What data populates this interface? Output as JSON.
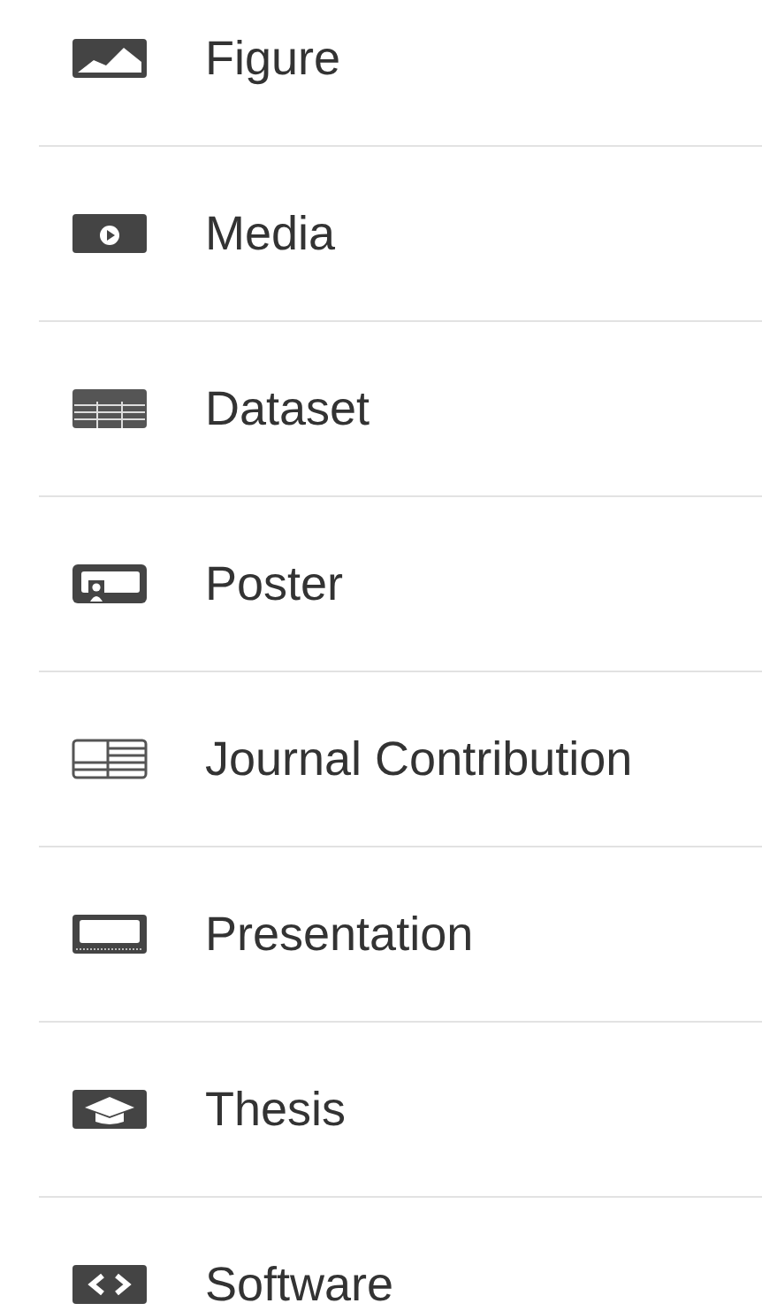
{
  "items": [
    {
      "label": "Figure",
      "kind": "figure"
    },
    {
      "label": "Media",
      "kind": "media"
    },
    {
      "label": "Dataset",
      "kind": "dataset"
    },
    {
      "label": "Poster",
      "kind": "poster"
    },
    {
      "label": "Journal Contribution",
      "kind": "journal"
    },
    {
      "label": "Presentation",
      "kind": "presentation"
    },
    {
      "label": "Thesis",
      "kind": "thesis"
    },
    {
      "label": "Software",
      "kind": "software"
    }
  ]
}
